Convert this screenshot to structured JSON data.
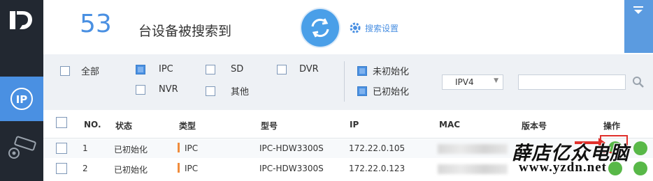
{
  "sidebar": {
    "logo_icon": "dahua-logo-icon",
    "items": [
      {
        "icon": "ip-device-icon",
        "active": true
      },
      {
        "icon": "camera-settings-icon",
        "active": false
      }
    ]
  },
  "header": {
    "device_count": "53",
    "count_label": "台设备被搜索到",
    "refresh_icon": "refresh-icon",
    "settings_label": "搜索设置"
  },
  "filters": {
    "device_types": [
      {
        "label": "全部",
        "checked": false
      },
      {
        "label": "IPC",
        "checked": true
      },
      {
        "label": "SD",
        "checked": false
      },
      {
        "label": "DVR",
        "checked": false
      },
      {
        "label": "NVR",
        "checked": false
      },
      {
        "label": "其他",
        "checked": false
      }
    ],
    "init_states": [
      {
        "label": "未初始化",
        "checked": true
      },
      {
        "label": "已初始化",
        "checked": true
      }
    ],
    "ip_version": "IPV4",
    "search_value": ""
  },
  "table": {
    "columns": [
      "NO.",
      "状态",
      "类型",
      "型号",
      "IP",
      "MAC",
      "版本号",
      "操作"
    ],
    "rows": [
      {
        "no": "1",
        "status": "已初始化",
        "type": "IPC",
        "model": "IPC-HDW3300S",
        "ip": "172.22.0.105"
      },
      {
        "no": "2",
        "status": "已初始化",
        "type": "IPC",
        "model": "IPC-HDW3300S",
        "ip": "172.22.0.123"
      }
    ]
  },
  "watermark": {
    "line1": "薛店亿众电脑",
    "line2": "www.yzdn.net"
  },
  "colors": {
    "accent": "#4a90e2",
    "sidebar": "#222831",
    "type_marker": "#f08c3c",
    "op_button": "#58b848",
    "highlight": "#e0302c"
  }
}
